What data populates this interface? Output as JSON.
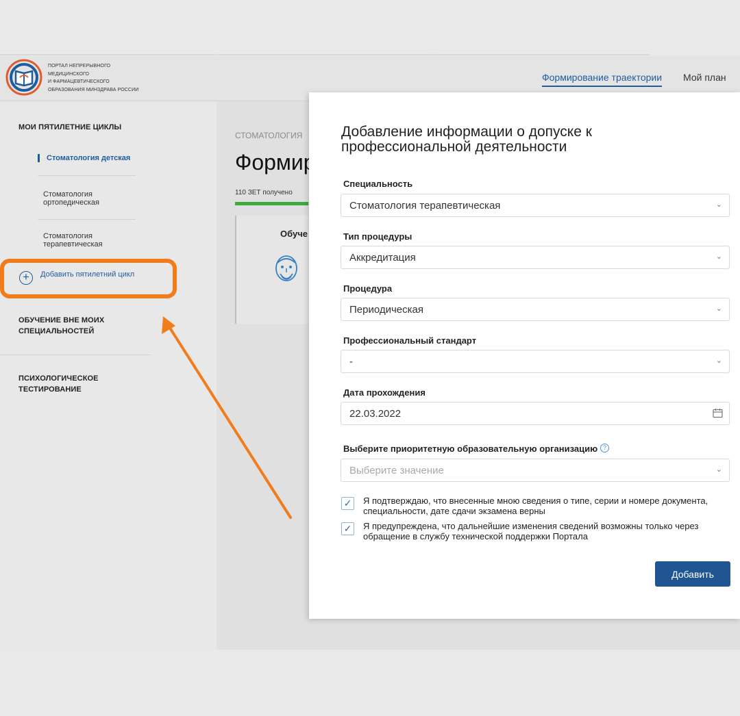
{
  "header": {
    "logo_lines": [
      "Портал непрерывного",
      "медицинского",
      "и фармацевтического",
      "образования Минздрава России"
    ],
    "nav": [
      {
        "label": "Формирование траектории",
        "active": true
      },
      {
        "label": "Мой план",
        "active": false
      }
    ]
  },
  "sidebar": {
    "cycles_title": "Мои пятилетние циклы",
    "items": [
      {
        "label": "Стоматология детская",
        "active": true
      },
      {
        "label": "Стоматология ортопедическая",
        "active": false
      },
      {
        "label": "Стоматология терапевтическая",
        "active": false
      }
    ],
    "add_cycle_label": "Добавить пятилетний цикл",
    "other_training": "Обучение вне моих специальностей",
    "psych_testing": "Психологическое тестирование"
  },
  "main": {
    "breadcrumb": "Стоматология",
    "title": "Формир",
    "zet_text": "110 ЗЕТ получено",
    "progress_fraction": 0.97,
    "card_title": "Обуче"
  },
  "modal": {
    "title": "Добавление информации о допуске к профессиональной деятельности",
    "fields": {
      "specialty": {
        "label": "Специальность",
        "value": "Стоматология терапевтическая"
      },
      "procedure_type": {
        "label": "Тип процедуры",
        "value": "Аккредитация"
      },
      "procedure": {
        "label": "Процедура",
        "value": "Периодическая"
      },
      "prof_standard": {
        "label": "Профессиональный стандарт",
        "value": "-"
      },
      "date": {
        "label": "Дата прохождения",
        "value": "22.03.2022"
      },
      "organization": {
        "label": "Выберите приоритетную образовательную организацию",
        "placeholder": "Выберите значение"
      }
    },
    "checkboxes": [
      {
        "text": "Я подтверждаю, что внесенные мною сведения о типе, серии и номере документа, специальности, дате сдачи экзамена верны",
        "checked": true
      },
      {
        "text": "Я предупреждена, что дальнейшие изменения сведений возможны только через обращение в службу технической поддержки Портала",
        "checked": true
      }
    ],
    "add_button": "Добавить"
  },
  "colors": {
    "accent": "#1f5c9e",
    "button": "#1f5590",
    "highlight": "#f07c1c",
    "progress": "#3caa3c"
  }
}
